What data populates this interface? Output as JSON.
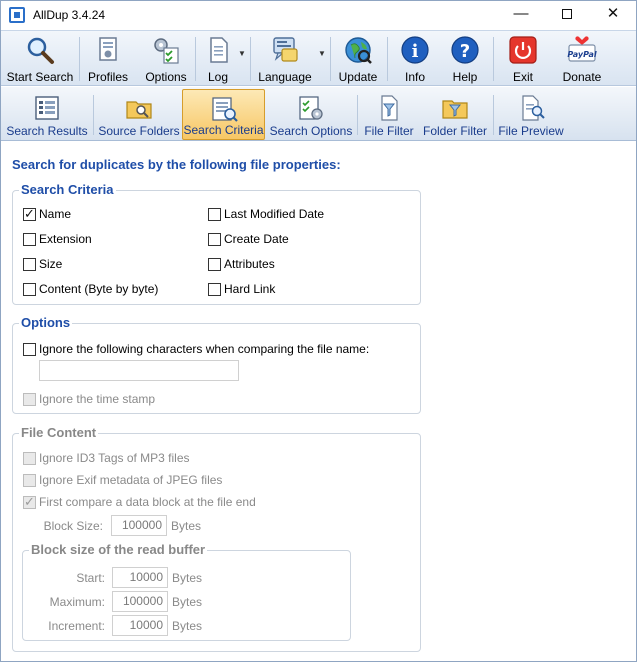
{
  "window": {
    "title": "AllDup 3.4.24"
  },
  "toolbar": {
    "items": [
      {
        "label": "Start Search",
        "icon": "magnifier-icon"
      },
      {
        "label": "Profiles",
        "icon": "profiles-icon"
      },
      {
        "label": "Options",
        "icon": "gear-checklist-icon"
      },
      {
        "label": "Log",
        "icon": "document-icon"
      },
      {
        "label": "Language",
        "icon": "language-icon"
      },
      {
        "label": "Update",
        "icon": "globe-icon"
      },
      {
        "label": "Info",
        "icon": "info-icon"
      },
      {
        "label": "Help",
        "icon": "help-icon"
      },
      {
        "label": "Exit",
        "icon": "power-icon"
      },
      {
        "label": "Donate",
        "icon": "paypal-icon"
      }
    ],
    "paypal_text": "PayPal"
  },
  "tabs": {
    "items": [
      {
        "label": "Search Results"
      },
      {
        "label": "Source Folders"
      },
      {
        "label": "Search Criteria"
      },
      {
        "label": "Search Options"
      },
      {
        "label": "File Filter"
      },
      {
        "label": "Folder Filter"
      },
      {
        "label": "File Preview"
      }
    ],
    "active": "Search Criteria"
  },
  "heading": "Search for duplicates by the following file properties:",
  "criteria": {
    "title": "Search Criteria",
    "left": [
      {
        "label": "Name",
        "checked": true
      },
      {
        "label": "Extension",
        "checked": false
      },
      {
        "label": "Size",
        "checked": false
      },
      {
        "label": "Content (Byte by byte)",
        "checked": false
      }
    ],
    "right": [
      {
        "label": "Last Modified Date",
        "checked": false
      },
      {
        "label": "Create Date",
        "checked": false
      },
      {
        "label": "Attributes",
        "checked": false
      },
      {
        "label": "Hard Link",
        "checked": false
      }
    ]
  },
  "options": {
    "title": "Options",
    "ignore_chars_label": "Ignore the following characters when comparing the file name:",
    "ignore_chars_value": "",
    "ignore_timestamp_label": "Ignore the time stamp"
  },
  "file_content": {
    "title": "File Content",
    "id3_label": "Ignore ID3 Tags of MP3 files",
    "exif_label": "Ignore Exif metadata of JPEG files",
    "first_compare_label": "First compare a data block at the file end",
    "block_size_label": "Block Size:",
    "block_size_value": "100000",
    "block_size_unit": "Bytes",
    "read_buffer": {
      "title": "Block size of the read buffer",
      "start_label": "Start:",
      "start_value": "10000",
      "maximum_label": "Maximum:",
      "maximum_value": "100000",
      "increment_label": "Increment:",
      "increment_value": "10000",
      "unit": "Bytes"
    }
  }
}
